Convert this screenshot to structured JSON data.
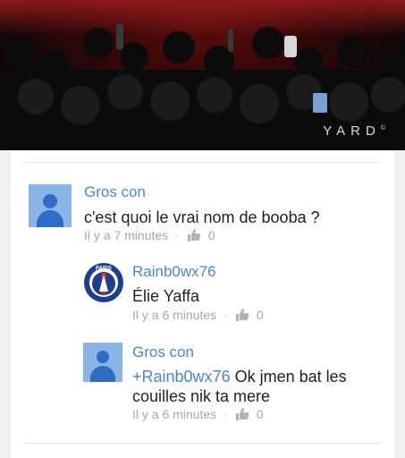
{
  "video": {
    "brand": "YARD",
    "brand_mark": "©"
  },
  "comments": [
    {
      "author": "Gros con",
      "text": "c'est quoi le vrai nom de booba ?",
      "time": "Il y a 7 minutes",
      "likes": "0",
      "avatar": "default-user-icon"
    },
    {
      "author": "Rainb0wx76",
      "text": "Élie Yaffa",
      "time": "Il y a 6 minutes",
      "likes": "0",
      "avatar": "psg-crest",
      "avatar_text": "PARIS"
    },
    {
      "author": "Gros con",
      "mention": "+Rainb0wx76",
      "text_line1": " Ok jmen bat les",
      "text_line2": "couilles nik ta mere",
      "time": "Il y a 6 minutes",
      "likes": "0",
      "avatar": "default-user-icon"
    }
  ],
  "colors": {
    "author": "#4c86c8",
    "avatar_bg": "#8ab4e6",
    "avatar_fg": "#2f6dc4",
    "psg_blue": "#1c3f8c",
    "psg_red": "#d62a2a"
  }
}
